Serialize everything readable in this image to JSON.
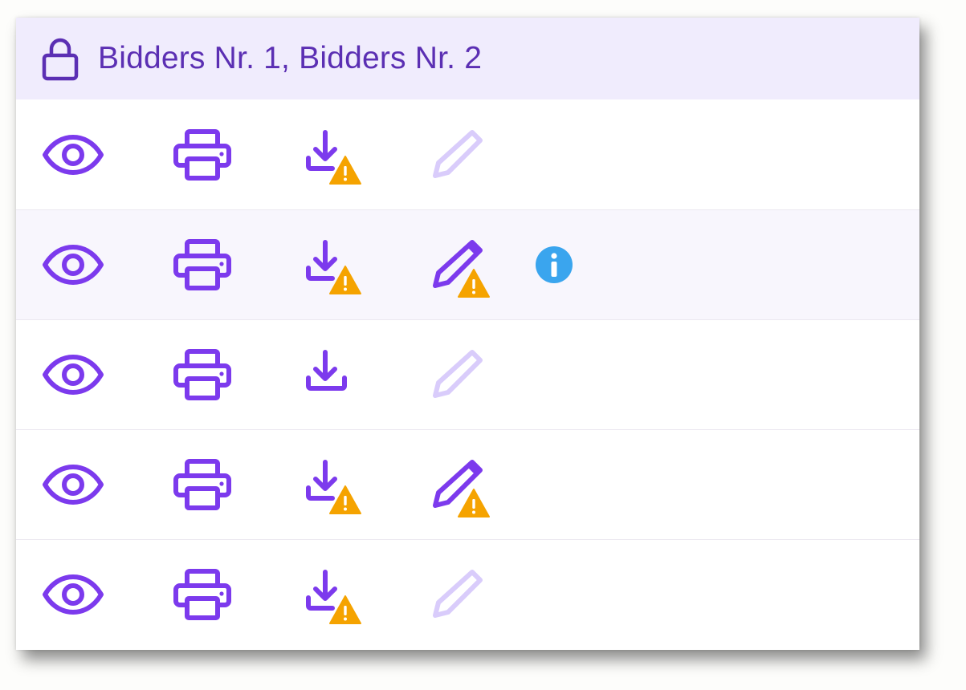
{
  "header": {
    "title": "Bidders Nr. 1, Bidders Nr. 2",
    "icon": "lock-icon"
  },
  "colors": {
    "primary": "#7c3aed",
    "header_bg": "#f0ecfd",
    "header_text": "#5b2fb3",
    "disabled": "#d9ccfb",
    "warning": "#f5a300",
    "info": "#3aa5ee",
    "highlight_row": "#f8f6fd"
  },
  "rows": [
    {
      "view": "eye-icon",
      "print": "printer-icon",
      "download_warning": true,
      "edit_enabled": false,
      "edit_warning": false,
      "info": false,
      "highlighted": false
    },
    {
      "view": "eye-icon",
      "print": "printer-icon",
      "download_warning": true,
      "edit_enabled": true,
      "edit_warning": true,
      "info": true,
      "highlighted": true
    },
    {
      "view": "eye-icon",
      "print": "printer-icon",
      "download_warning": false,
      "edit_enabled": false,
      "edit_warning": false,
      "info": false,
      "highlighted": false
    },
    {
      "view": "eye-icon",
      "print": "printer-icon",
      "download_warning": true,
      "edit_enabled": true,
      "edit_warning": true,
      "info": false,
      "highlighted": false
    },
    {
      "view": "eye-icon",
      "print": "printer-icon",
      "download_warning": true,
      "edit_enabled": false,
      "edit_warning": false,
      "info": false,
      "highlighted": false
    }
  ]
}
